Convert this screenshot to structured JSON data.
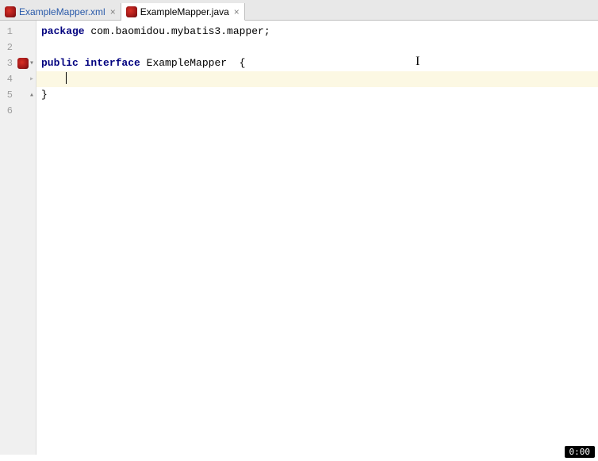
{
  "tabs": [
    {
      "label": "ExampleMapper.xml",
      "active": false
    },
    {
      "label": "ExampleMapper.java",
      "active": true
    }
  ],
  "gutter": {
    "lines": [
      "1",
      "2",
      "3",
      "4",
      "5",
      "6"
    ]
  },
  "code": {
    "line1_kw": "package",
    "line1_rest": " com.baomidou.mybatis3.mapper;",
    "line3_kw1": "public",
    "line3_kw2": "interface",
    "line3_rest": " ExampleMapper  {",
    "line5": "}"
  },
  "status": {
    "time": "0:00"
  }
}
